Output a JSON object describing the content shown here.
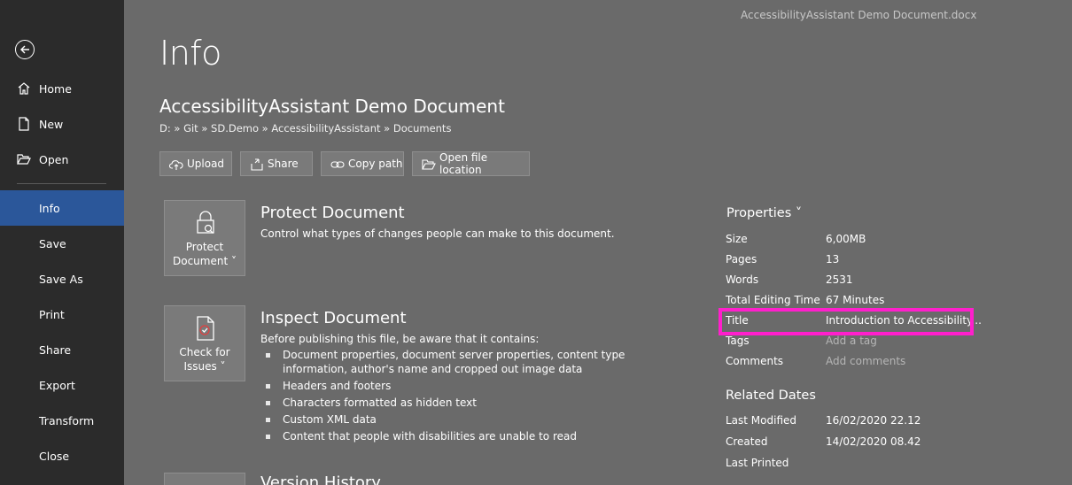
{
  "window": {
    "file_name": "AccessibilityAssistant Demo Document.docx"
  },
  "sidebar": {
    "items": [
      {
        "label": "Home",
        "icon": "home-icon"
      },
      {
        "label": "New",
        "icon": "new-document-icon"
      },
      {
        "label": "Open",
        "icon": "folder-open-icon"
      },
      {
        "label": "Info",
        "active": true
      },
      {
        "label": "Save"
      },
      {
        "label": "Save As"
      },
      {
        "label": "Print"
      },
      {
        "label": "Share"
      },
      {
        "label": "Export"
      },
      {
        "label": "Transform"
      },
      {
        "label": "Close"
      }
    ]
  },
  "main": {
    "title": "Info",
    "doc_name": "AccessibilityAssistant Demo Document",
    "breadcrumb": "D: » Git » SD.Demo » AccessibilityAssistant » Documents",
    "toolbar": {
      "upload": "Upload",
      "share": "Share",
      "copy_path": "Copy path",
      "open_location": "Open file location"
    },
    "protect": {
      "button_line1": "Protect",
      "button_line2": "Document ˅",
      "title": "Protect Document",
      "desc": "Control what types of changes people can make to this document."
    },
    "inspect": {
      "button_line1": "Check for",
      "button_line2": "Issues ˅",
      "title": "Inspect Document",
      "desc": "Before publishing this file, be aware that it contains:",
      "bullets": [
        "Document properties, document server properties, content type information, author's name and cropped out image data",
        "Headers and footers",
        "Characters formatted as hidden text",
        "Custom XML data",
        "Content that people with disabilities are unable to read"
      ]
    },
    "version": {
      "title": "Version History"
    }
  },
  "properties": {
    "heading": "Properties ˅",
    "rows": [
      {
        "k": "Size",
        "v": "6,00MB"
      },
      {
        "k": "Pages",
        "v": "13"
      },
      {
        "k": "Words",
        "v": "2531"
      },
      {
        "k": "Total Editing Time",
        "v": "67 Minutes"
      },
      {
        "k": "Title",
        "v": "Introduction to Accessibility..."
      },
      {
        "k": "Tags",
        "v": "Add a tag"
      },
      {
        "k": "Comments",
        "v": "Add comments"
      }
    ],
    "related_heading": "Related Dates",
    "dates": [
      {
        "k": "Last Modified",
        "v": "16/02/2020 22.12"
      },
      {
        "k": "Created",
        "v": "14/02/2020 08.42"
      },
      {
        "k": "Last Printed",
        "v": ""
      }
    ]
  },
  "colors": {
    "sidebar_bg": "#2b2b2b",
    "active_bg": "#2b579a",
    "main_bg": "#6a6a6a",
    "highlight": "#ff1fcc"
  }
}
